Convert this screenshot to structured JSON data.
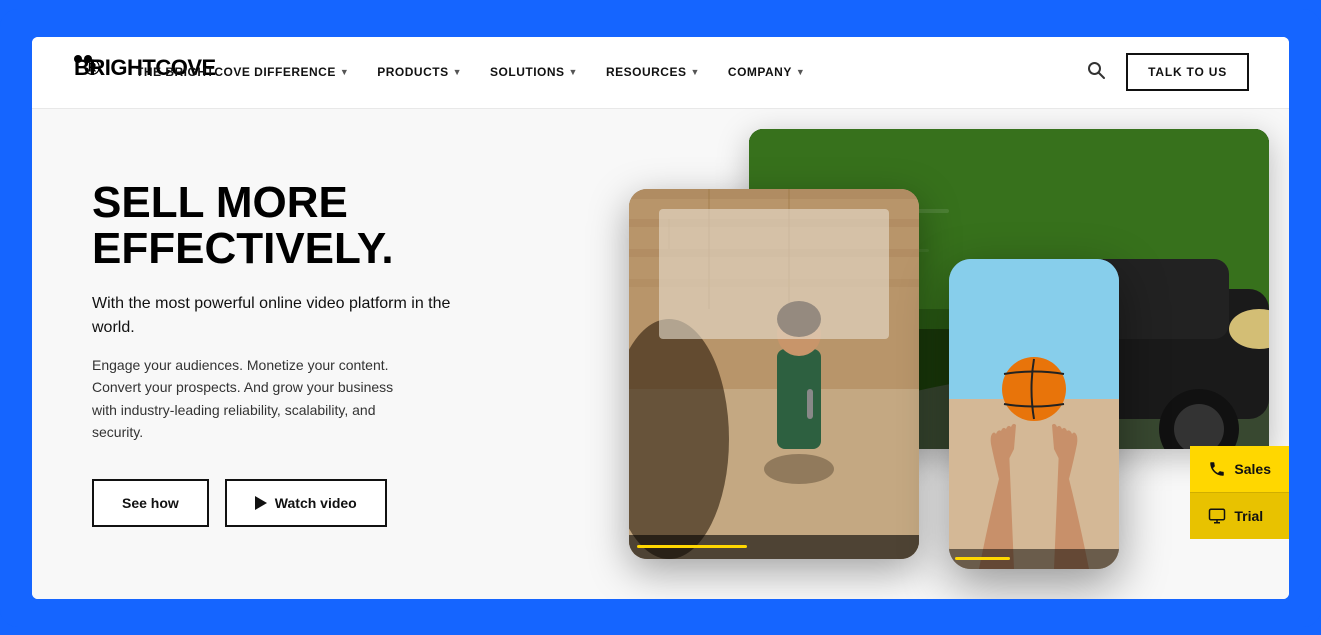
{
  "page": {
    "background_color": "#1565FF"
  },
  "navbar": {
    "logo_text": "BRIGHTCOVE",
    "logo_trademark": "®",
    "nav_items": [
      {
        "label": "THE BRIGHTCOVE DIFFERENCE",
        "has_dropdown": true
      },
      {
        "label": "PRODUCTS",
        "has_dropdown": true
      },
      {
        "label": "SOLUTIONS",
        "has_dropdown": true
      },
      {
        "label": "RESOURCES",
        "has_dropdown": true
      },
      {
        "label": "COMPANY",
        "has_dropdown": true
      }
    ],
    "talk_to_us_label": "TALK TO US",
    "search_icon": "🔍"
  },
  "hero": {
    "headline_line1": "SELL MORE",
    "headline_line2": "EFFECTIVELY.",
    "subtitle": "With the most powerful online video platform in the world.",
    "body_text": "Engage your audiences. Monetize your content. Convert your prospects. And grow your business with industry-leading reliability, scalability, and security.",
    "btn_see_how": "See how",
    "btn_watch_video": "Watch video"
  },
  "floating_cta": {
    "sales_label": "Sales",
    "trial_label": "Trial",
    "phone_icon": "📞",
    "monitor_icon": "🖥"
  }
}
